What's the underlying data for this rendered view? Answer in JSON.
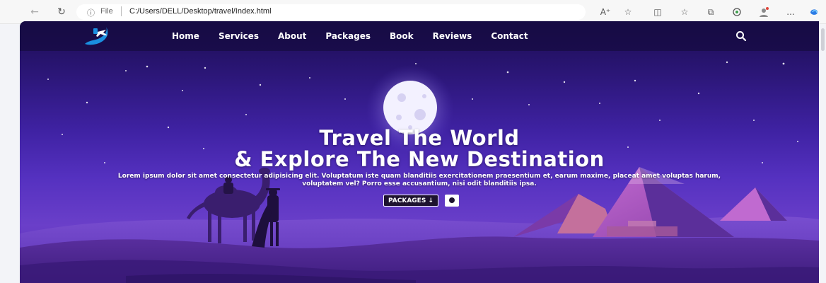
{
  "browser": {
    "address": {
      "info_icon": "info-icon",
      "scheme_label": "File",
      "url": "C:/Users/DELL/Desktop/travel/Index.html"
    },
    "icons": [
      "back-arrow-icon",
      "refresh-icon",
      "read-aloud-icon",
      "favorite-star-icon",
      "split-screen-icon",
      "favorites-list-icon",
      "collections-icon",
      "extensions-icon",
      "profile-icon",
      "more-icon",
      "copilot-icon"
    ],
    "more_label": "..."
  },
  "site": {
    "logo": "travel-plane-logo",
    "nav": {
      "items": [
        "Home",
        "Services",
        "About",
        "Packages",
        "Book",
        "Reviews",
        "Contact"
      ]
    },
    "search_icon": "search-icon",
    "hero": {
      "title_line1": "Travel The World",
      "title_line2": "& Explore The New Destination",
      "text": "Lorem ipsum dolor sit amet consectetur adipisicing elit. Voluptatum iste quam blanditiis exercitationem praesentium et, earum maxime, placeat amet voluptas harum, voluptatem vel? Porro esse accusantium, nisi odit blanditiis ipsa.",
      "primary_button": "PACKAGES ↓",
      "play_button_icon": "play-circle-icon"
    },
    "colors": {
      "sky_top": "#1c0d52",
      "sky_mid": "#3f22a3",
      "sky_bottom": "#6a3fc9",
      "accent_blue": "#1a8fe0"
    }
  }
}
